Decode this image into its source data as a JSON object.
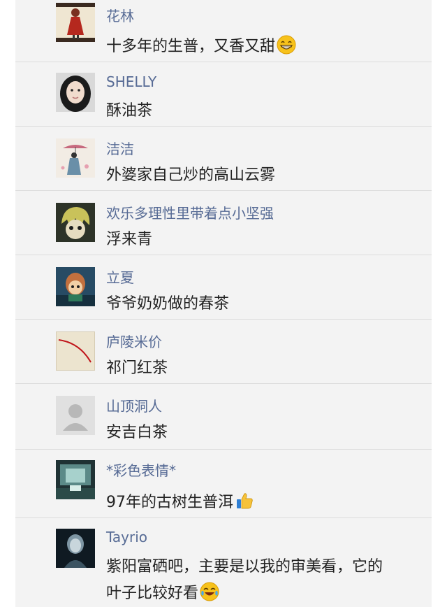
{
  "comments": [
    {
      "name": "花林",
      "text": "十多年的生普，又香又甜",
      "emoji": "grinning-face-icon",
      "avatar": "woman-in-red-dress-illustration"
    },
    {
      "name": "SHELLY",
      "text": "酥油茶",
      "emoji": "",
      "avatar": "girl-portrait-photo"
    },
    {
      "name": "洁洁",
      "text": "外婆家自己炒的高山云雾",
      "emoji": "",
      "avatar": "woman-with-umbrella-painting"
    },
    {
      "name": "欢乐多理性里带着点小坚强",
      "text": "浮来青",
      "emoji": "",
      "avatar": "anime-boy-character"
    },
    {
      "name": "立夏",
      "text": "爷爷奶奶做的春茶",
      "emoji": "",
      "avatar": "cartoon-doll-character"
    },
    {
      "name": "庐陵米价",
      "text": "祁门红茶",
      "emoji": "",
      "avatar": "red-line-on-paper"
    },
    {
      "name": "山顶洞人",
      "text": "安吉白茶",
      "emoji": "",
      "avatar": "default-person-icon"
    },
    {
      "name": "*彩色表情*",
      "text": "97年的古树生普洱",
      "emoji": "thumbs-up-icon",
      "avatar": "dark-scene-photo"
    },
    {
      "name": "Tayrio",
      "text": "紫阳富硒吧，主要是以我的审美看，它的",
      "text2": "叶子比较好看",
      "emoji": "tears-of-joy-face-icon",
      "avatar": "ghostly-figure-photo"
    }
  ]
}
